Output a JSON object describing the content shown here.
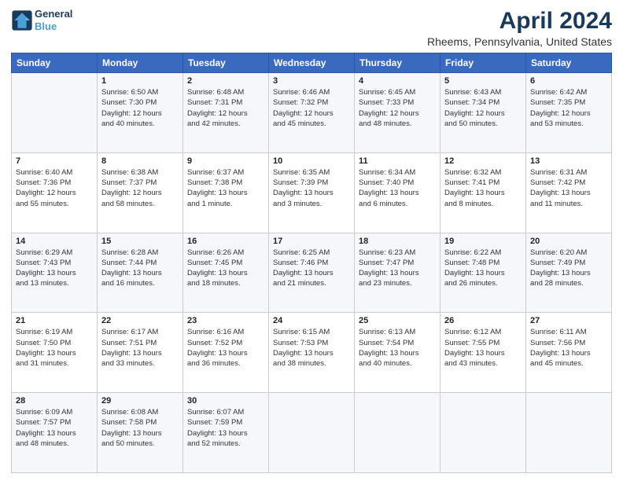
{
  "logo": {
    "line1": "General",
    "line2": "Blue"
  },
  "title": "April 2024",
  "subtitle": "Rheems, Pennsylvania, United States",
  "headers": [
    "Sunday",
    "Monday",
    "Tuesday",
    "Wednesday",
    "Thursday",
    "Friday",
    "Saturday"
  ],
  "weeks": [
    [
      {
        "day": "",
        "text": ""
      },
      {
        "day": "1",
        "text": "Sunrise: 6:50 AM\nSunset: 7:30 PM\nDaylight: 12 hours\nand 40 minutes."
      },
      {
        "day": "2",
        "text": "Sunrise: 6:48 AM\nSunset: 7:31 PM\nDaylight: 12 hours\nand 42 minutes."
      },
      {
        "day": "3",
        "text": "Sunrise: 6:46 AM\nSunset: 7:32 PM\nDaylight: 12 hours\nand 45 minutes."
      },
      {
        "day": "4",
        "text": "Sunrise: 6:45 AM\nSunset: 7:33 PM\nDaylight: 12 hours\nand 48 minutes."
      },
      {
        "day": "5",
        "text": "Sunrise: 6:43 AM\nSunset: 7:34 PM\nDaylight: 12 hours\nand 50 minutes."
      },
      {
        "day": "6",
        "text": "Sunrise: 6:42 AM\nSunset: 7:35 PM\nDaylight: 12 hours\nand 53 minutes."
      }
    ],
    [
      {
        "day": "7",
        "text": "Sunrise: 6:40 AM\nSunset: 7:36 PM\nDaylight: 12 hours\nand 55 minutes."
      },
      {
        "day": "8",
        "text": "Sunrise: 6:38 AM\nSunset: 7:37 PM\nDaylight: 12 hours\nand 58 minutes."
      },
      {
        "day": "9",
        "text": "Sunrise: 6:37 AM\nSunset: 7:38 PM\nDaylight: 13 hours\nand 1 minute."
      },
      {
        "day": "10",
        "text": "Sunrise: 6:35 AM\nSunset: 7:39 PM\nDaylight: 13 hours\nand 3 minutes."
      },
      {
        "day": "11",
        "text": "Sunrise: 6:34 AM\nSunset: 7:40 PM\nDaylight: 13 hours\nand 6 minutes."
      },
      {
        "day": "12",
        "text": "Sunrise: 6:32 AM\nSunset: 7:41 PM\nDaylight: 13 hours\nand 8 minutes."
      },
      {
        "day": "13",
        "text": "Sunrise: 6:31 AM\nSunset: 7:42 PM\nDaylight: 13 hours\nand 11 minutes."
      }
    ],
    [
      {
        "day": "14",
        "text": "Sunrise: 6:29 AM\nSunset: 7:43 PM\nDaylight: 13 hours\nand 13 minutes."
      },
      {
        "day": "15",
        "text": "Sunrise: 6:28 AM\nSunset: 7:44 PM\nDaylight: 13 hours\nand 16 minutes."
      },
      {
        "day": "16",
        "text": "Sunrise: 6:26 AM\nSunset: 7:45 PM\nDaylight: 13 hours\nand 18 minutes."
      },
      {
        "day": "17",
        "text": "Sunrise: 6:25 AM\nSunset: 7:46 PM\nDaylight: 13 hours\nand 21 minutes."
      },
      {
        "day": "18",
        "text": "Sunrise: 6:23 AM\nSunset: 7:47 PM\nDaylight: 13 hours\nand 23 minutes."
      },
      {
        "day": "19",
        "text": "Sunrise: 6:22 AM\nSunset: 7:48 PM\nDaylight: 13 hours\nand 26 minutes."
      },
      {
        "day": "20",
        "text": "Sunrise: 6:20 AM\nSunset: 7:49 PM\nDaylight: 13 hours\nand 28 minutes."
      }
    ],
    [
      {
        "day": "21",
        "text": "Sunrise: 6:19 AM\nSunset: 7:50 PM\nDaylight: 13 hours\nand 31 minutes."
      },
      {
        "day": "22",
        "text": "Sunrise: 6:17 AM\nSunset: 7:51 PM\nDaylight: 13 hours\nand 33 minutes."
      },
      {
        "day": "23",
        "text": "Sunrise: 6:16 AM\nSunset: 7:52 PM\nDaylight: 13 hours\nand 36 minutes."
      },
      {
        "day": "24",
        "text": "Sunrise: 6:15 AM\nSunset: 7:53 PM\nDaylight: 13 hours\nand 38 minutes."
      },
      {
        "day": "25",
        "text": "Sunrise: 6:13 AM\nSunset: 7:54 PM\nDaylight: 13 hours\nand 40 minutes."
      },
      {
        "day": "26",
        "text": "Sunrise: 6:12 AM\nSunset: 7:55 PM\nDaylight: 13 hours\nand 43 minutes."
      },
      {
        "day": "27",
        "text": "Sunrise: 6:11 AM\nSunset: 7:56 PM\nDaylight: 13 hours\nand 45 minutes."
      }
    ],
    [
      {
        "day": "28",
        "text": "Sunrise: 6:09 AM\nSunset: 7:57 PM\nDaylight: 13 hours\nand 48 minutes."
      },
      {
        "day": "29",
        "text": "Sunrise: 6:08 AM\nSunset: 7:58 PM\nDaylight: 13 hours\nand 50 minutes."
      },
      {
        "day": "30",
        "text": "Sunrise: 6:07 AM\nSunset: 7:59 PM\nDaylight: 13 hours\nand 52 minutes."
      },
      {
        "day": "",
        "text": ""
      },
      {
        "day": "",
        "text": ""
      },
      {
        "day": "",
        "text": ""
      },
      {
        "day": "",
        "text": ""
      }
    ]
  ]
}
